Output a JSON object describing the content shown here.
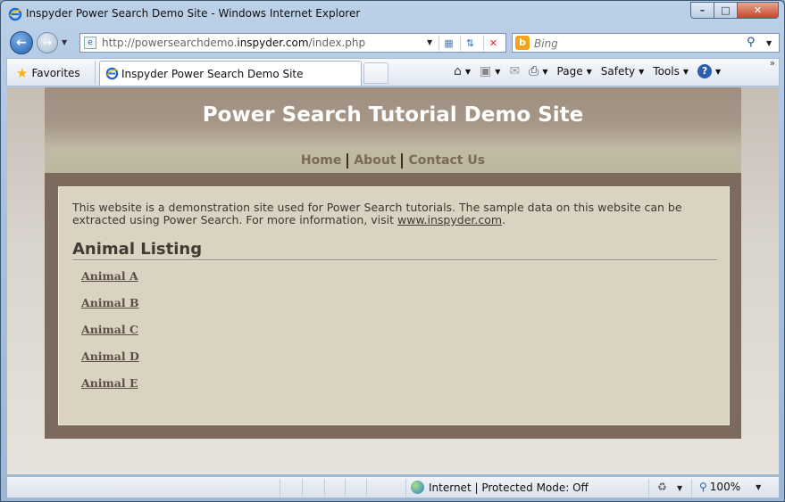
{
  "window": {
    "title": "Inspyder Power Search Demo Site - Windows Internet Explorer",
    "controls": {
      "minimize": "–",
      "maximize": "□",
      "close": "✕"
    }
  },
  "navbar": {
    "url_prefix": "http://powersearchdemo.",
    "url_domain": "inspyder.com",
    "url_suffix": "/index.php",
    "search_placeholder": "Bing",
    "search_logo": "b"
  },
  "favbar": {
    "favorites_label": "Favorites",
    "tab_label": "Inspyder Power Search Demo Site",
    "commands": {
      "page": "Page",
      "safety": "Safety",
      "tools": "Tools",
      "help": "?"
    }
  },
  "site": {
    "title": "Power Search Tutorial Demo Site",
    "nav": [
      "Home",
      "About",
      "Contact Us"
    ],
    "intro_text": "This website is a demonstration site used for Power Search tutorials. The sample data on this website can be extracted using Power Search. For more information, visit",
    "intro_link": "www.inspyder.com",
    "intro_end": ".",
    "listing_title": "Animal Listing",
    "animals": [
      "Animal A",
      "Animal B",
      "Animal C",
      "Animal D",
      "Animal E"
    ]
  },
  "statusbar": {
    "zone_text": "Internet | Protected Mode: Off",
    "zoom": "100%"
  }
}
